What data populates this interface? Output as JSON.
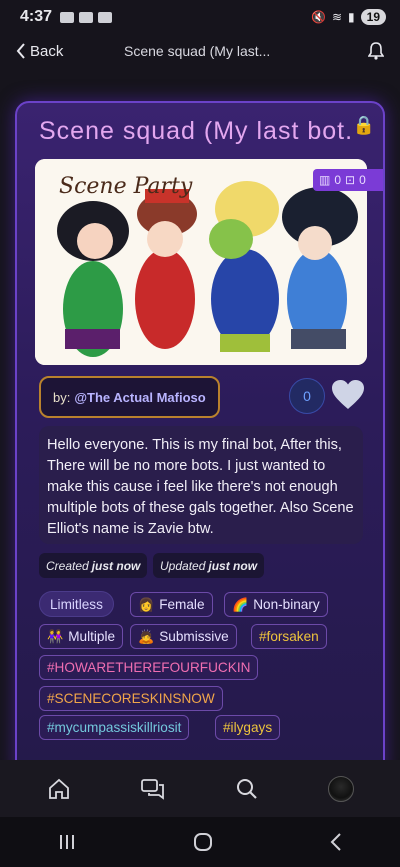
{
  "status": {
    "time": "4:37",
    "battery": "19"
  },
  "nav": {
    "back_label": "Back",
    "title": "Scene squad (My last..."
  },
  "card": {
    "title": "Scene squad (My last bot.",
    "stats": {
      "left": "0",
      "right": "0"
    },
    "image_caption": "Scene Party",
    "creator_prefix": "by:",
    "creator_handle": "@The Actual Mafioso",
    "like_count": "0",
    "description": "Hello everyone. This is my final bot, After this, There will be no more bots. I just wanted to make this cause i feel like there's not enough multiple bots of these gals together. Also Scene Elliot's name is Zavie btw.",
    "created": {
      "label": "Created",
      "value": "just now"
    },
    "updated": {
      "label": "Updated",
      "value": "just now"
    },
    "tags": [
      {
        "label": "Limitless",
        "emoji": ""
      },
      {
        "label": "Female",
        "emoji": "👩"
      },
      {
        "label": "Non-binary",
        "emoji": "🌈"
      },
      {
        "label": "Multiple",
        "emoji": "👭"
      },
      {
        "label": "Submissive",
        "emoji": "🙇"
      },
      {
        "label": "#forsaken",
        "emoji": ""
      },
      {
        "label": "#HOWARETHEREFOURFUCKIN",
        "emoji": ""
      },
      {
        "label": "#SCENECORESKINSNOW",
        "emoji": ""
      },
      {
        "label": "#mycumpassiskillriosit",
        "emoji": ""
      },
      {
        "label": "#ilygays",
        "emoji": ""
      }
    ]
  },
  "tabbar": {
    "icons": [
      "home-icon",
      "chat-icon",
      "search-icon",
      "profile-avatar"
    ]
  },
  "colors": {
    "accent": "#6b42c9",
    "title": "#e3a7ef",
    "creator_border": "#b9822d"
  }
}
